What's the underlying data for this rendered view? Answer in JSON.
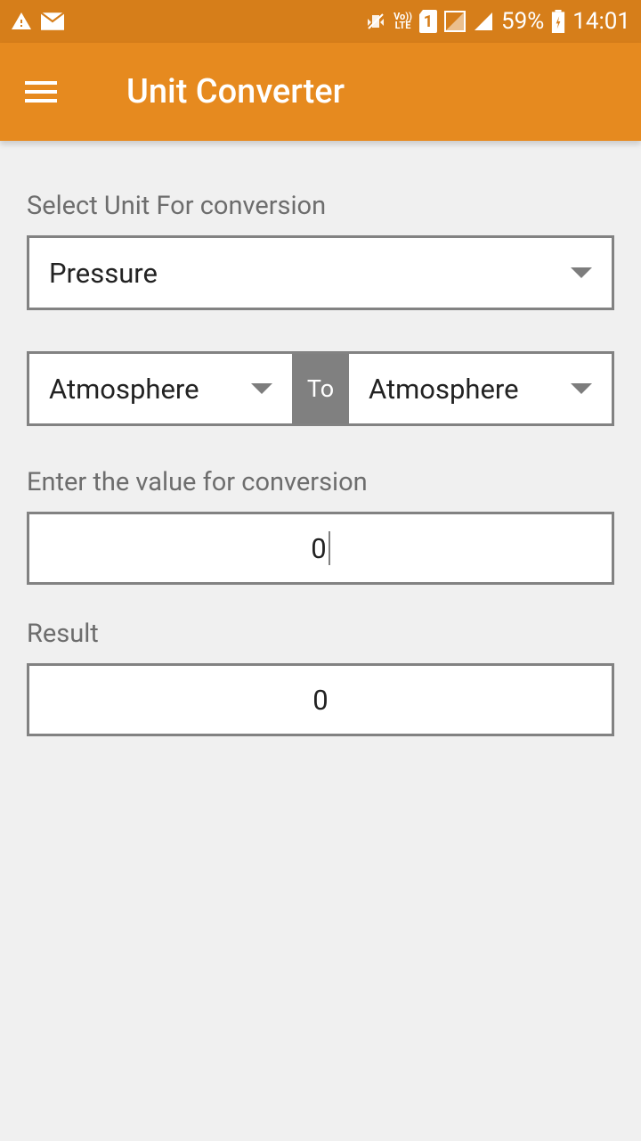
{
  "status_bar": {
    "battery_percent": "59%",
    "time": "14:01",
    "sim": "1",
    "lte": "LTE",
    "vo": "Vo))"
  },
  "header": {
    "title": "Unit Converter"
  },
  "form": {
    "select_unit_label": "Select Unit For conversion",
    "unit_category": "Pressure",
    "from_unit": "Atmosphere",
    "to_label": "To",
    "to_unit": "Atmosphere",
    "enter_value_label": "Enter the value for conversion",
    "input_value": "0",
    "result_label": "Result",
    "result_value": "0"
  }
}
